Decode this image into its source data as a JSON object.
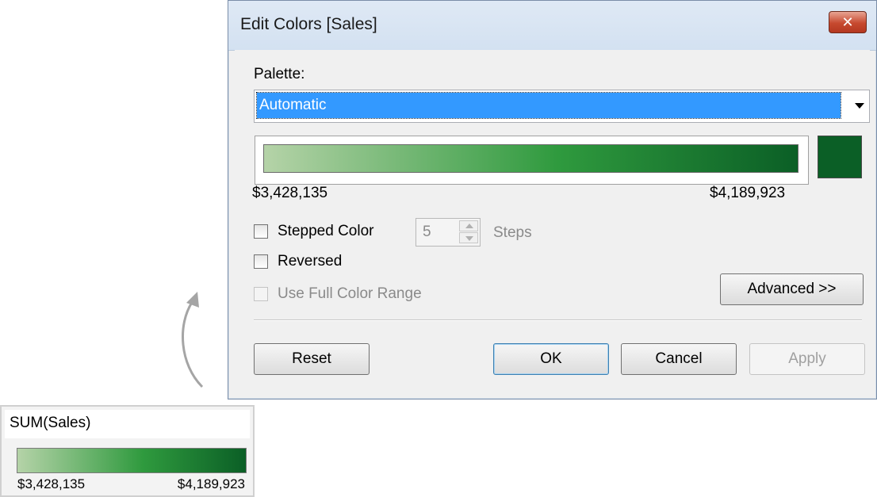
{
  "dialog": {
    "title": "Edit Colors [Sales]",
    "palette_label": "Palette:",
    "palette_value": "Automatic",
    "range_min": "$3,428,135",
    "range_max": "$4,189,923",
    "stepped_color_label": "Stepped Color",
    "steps_value": "5",
    "steps_label": "Steps",
    "reversed_label": "Reversed",
    "full_range_label": "Use Full Color Range",
    "advanced_label": "Advanced >>",
    "reset_label": "Reset",
    "ok_label": "OK",
    "cancel_label": "Cancel",
    "apply_label": "Apply"
  },
  "legend": {
    "title": "SUM(Sales)",
    "min": "$3,428,135",
    "max": "$4,189,923"
  },
  "colors": {
    "ramp_start": "#b5d3a8",
    "ramp_mid": "#2f9a3e",
    "ramp_end": "#0b5f26",
    "selection": "#3399ff"
  }
}
